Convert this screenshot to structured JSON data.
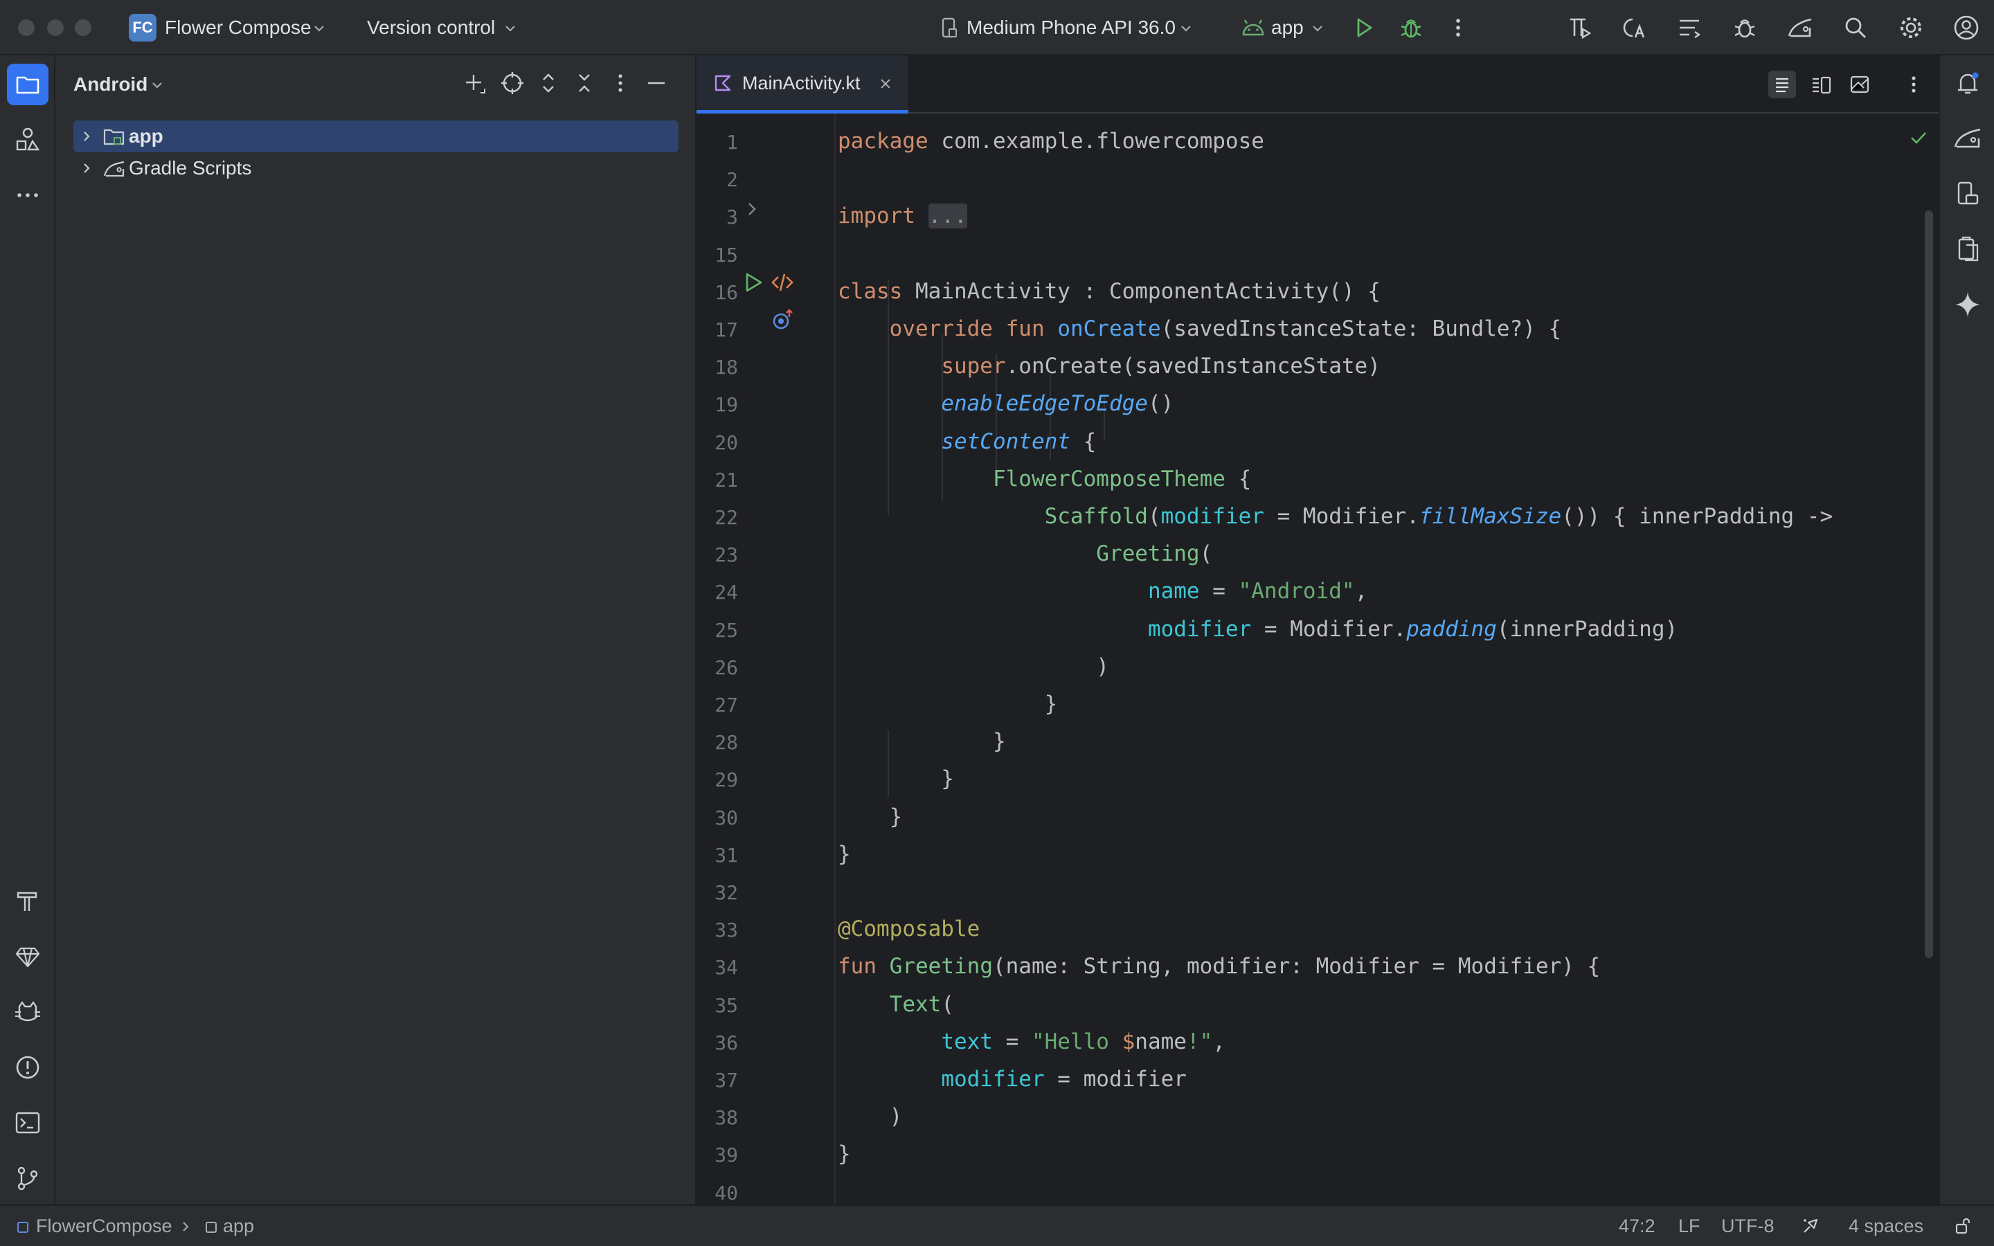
{
  "titlebar": {
    "project_badge": "FC",
    "project_name": "Flower Compose",
    "version_control": "Version control",
    "device": "Medium Phone API 36.0",
    "run_config": "app",
    "icons": [
      "run-icon",
      "debug-icon",
      "more-icon",
      "build-variant-icon",
      "translate-icon",
      "structure-icon",
      "profiler-icon",
      "device-manager-icon",
      "search-icon",
      "settings-icon",
      "account-icon"
    ]
  },
  "left_tools": [
    "project-folder-icon",
    "resource-manager-icon",
    "more-tools-icon",
    "build-icon",
    "gem-icon",
    "logcat-icon",
    "problems-icon",
    "terminal-icon",
    "git-icon"
  ],
  "project_panel": {
    "title": "Android",
    "tree": [
      {
        "label": "app",
        "selected": true
      },
      {
        "label": "Gradle Scripts",
        "selected": false
      }
    ]
  },
  "editor": {
    "tab_name": "MainActivity.kt",
    "colors": {
      "keyword": "#cf8e6d",
      "function": "#56a8f5",
      "string": "#6aab73",
      "param": "#3dc6d6",
      "annotation": "#b3ae60",
      "accent": "#3574f0"
    },
    "lines": [
      {
        "n": "1",
        "code": "package com.example.flowercompose"
      },
      {
        "n": "2",
        "code": ""
      },
      {
        "n": "3",
        "code": "import ..."
      },
      {
        "n": "15",
        "code": ""
      },
      {
        "n": "16",
        "code": "class MainActivity : ComponentActivity() {"
      },
      {
        "n": "17",
        "code": "    override fun onCreate(savedInstanceState: Bundle?) {"
      },
      {
        "n": "18",
        "code": "        super.onCreate(savedInstanceState)"
      },
      {
        "n": "19",
        "code": "        enableEdgeToEdge()"
      },
      {
        "n": "20",
        "code": "        setContent {"
      },
      {
        "n": "21",
        "code": "            FlowerComposeTheme {"
      },
      {
        "n": "22",
        "code": "                Scaffold(modifier = Modifier.fillMaxSize()) { innerPadding ->"
      },
      {
        "n": "23",
        "code": "                    Greeting("
      },
      {
        "n": "24",
        "code": "                        name = \"Android\","
      },
      {
        "n": "25",
        "code": "                        modifier = Modifier.padding(innerPadding)"
      },
      {
        "n": "26",
        "code": "                    )"
      },
      {
        "n": "27",
        "code": "                }"
      },
      {
        "n": "28",
        "code": "            }"
      },
      {
        "n": "29",
        "code": "        }"
      },
      {
        "n": "30",
        "code": "    }"
      },
      {
        "n": "31",
        "code": "}"
      },
      {
        "n": "32",
        "code": ""
      },
      {
        "n": "33",
        "code": "@Composable"
      },
      {
        "n": "34",
        "code": "fun Greeting(name: String, modifier: Modifier = Modifier) {"
      },
      {
        "n": "35",
        "code": "    Text("
      },
      {
        "n": "36",
        "code": "        text = \"Hello $name!\","
      },
      {
        "n": "37",
        "code": "        modifier = modifier"
      },
      {
        "n": "38",
        "code": "    )"
      },
      {
        "n": "39",
        "code": "}"
      },
      {
        "n": "40",
        "code": ""
      }
    ]
  },
  "right_tools": [
    "notifications-icon",
    "gradle-icon",
    "device-explorer-icon",
    "clipboard-icon",
    "gemini-icon"
  ],
  "statusbar": {
    "breadcrumb_root": "FlowerCompose",
    "breadcrumb_module": "app",
    "position": "47:2",
    "line_sep": "LF",
    "encoding": "UTF-8",
    "indent": "4 spaces"
  }
}
